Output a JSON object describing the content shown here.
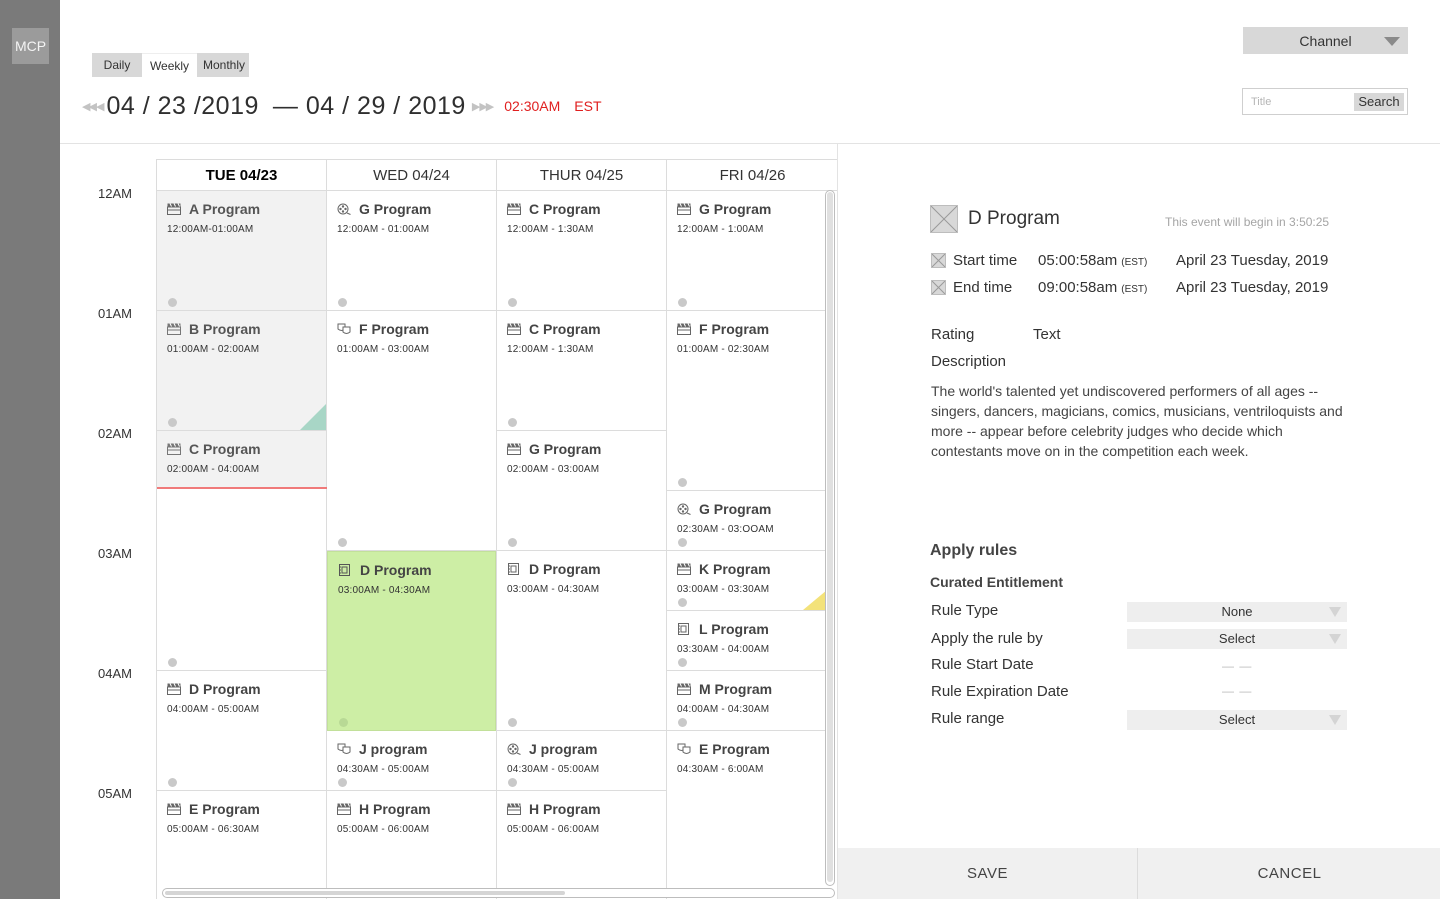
{
  "app": {
    "logo": "MCP"
  },
  "header": {
    "view_tabs": [
      "Daily",
      "Weekly",
      "Monthly"
    ],
    "active_tab": "Weekly",
    "date_start": "04 / 23 /2019",
    "date_separator": "—",
    "date_end": "04 / 29 / 2019",
    "current_time": "02:30AM",
    "timezone": "EST",
    "channel_label": "Channel",
    "search_placeholder": "Title",
    "search_button": "Search"
  },
  "calendar": {
    "time_labels": [
      "12AM",
      "01AM",
      "02AM",
      "03AM",
      "04AM",
      "05AM"
    ],
    "days": [
      "TUE 04/23",
      "WED 04/24",
      "THUR 04/25",
      "FRI 04/26"
    ],
    "active_day": "TUE 04/23",
    "events": {
      "tue": [
        {
          "title": "A Program",
          "time": "12:00AM-01:00AM",
          "icon": "clapperboard-icon"
        },
        {
          "title": "B  Program",
          "time": "01:00AM - 02:00AM",
          "icon": "clapperboard-icon"
        },
        {
          "title": "C Program",
          "time": "02:00AM - 04:00AM",
          "icon": "clapperboard-icon"
        },
        {
          "title": "D Program",
          "time": "04:00AM - 05:00AM",
          "icon": "clapperboard-icon"
        },
        {
          "title": "E Program",
          "time": "05:00AM - 06:30AM",
          "icon": "clapperboard-icon"
        }
      ],
      "wed": [
        {
          "title": "G Program",
          "time": "12:00AM - 01:00AM",
          "icon": "film-reel-icon"
        },
        {
          "title": "F Program",
          "time": "01:00AM - 03:00AM",
          "icon": "theater-masks-icon"
        },
        {
          "title": "D Program",
          "time": "03:00AM - 04:30AM",
          "icon": "film-strip-icon"
        },
        {
          "title": "J program",
          "time": "04:30AM - 05:00AM",
          "icon": "theater-masks-icon"
        },
        {
          "title": "H Program",
          "time": "05:00AM - 06:00AM",
          "icon": "clapperboard-icon"
        }
      ],
      "thu": [
        {
          "title": "C Program",
          "time": "12:00AM - 1:30AM",
          "icon": "clapperboard-icon"
        },
        {
          "title": "C Program",
          "time": "12:00AM - 1:30AM",
          "icon": "clapperboard-icon"
        },
        {
          "title": "G Program",
          "time": "02:00AM - 03:00AM",
          "icon": "clapperboard-icon"
        },
        {
          "title": "D Program",
          "time": "03:00AM - 04:30AM",
          "icon": "film-strip-icon"
        },
        {
          "title": "J program",
          "time": "04:30AM - 05:00AM",
          "icon": "film-reel-icon"
        },
        {
          "title": "H Program",
          "time": "05:00AM - 06:00AM",
          "icon": "clapperboard-icon"
        }
      ],
      "fri": [
        {
          "title": "G Program",
          "time": "12:00AM - 1:00AM",
          "icon": "clapperboard-icon"
        },
        {
          "title": "F Program",
          "time": "01:00AM - 02:30AM",
          "icon": "clapperboard-icon"
        },
        {
          "title": "G Program",
          "time": "02:30AM - 03:OOAM",
          "icon": "film-reel-icon"
        },
        {
          "title": "K Program",
          "time": "03:00AM - 03:30AM",
          "icon": "clapperboard-icon"
        },
        {
          "title": "L Program",
          "time": "03:30AM - 04:00AM",
          "icon": "film-strip-icon"
        },
        {
          "title": "M Program",
          "time": "04:00AM - 04:30AM",
          "icon": "clapperboard-icon"
        },
        {
          "title": "E Program",
          "time": "04:30AM - 6:00AM",
          "icon": "theater-masks-icon"
        }
      ]
    }
  },
  "detail": {
    "title": "D Program",
    "note": "This event will begin in 3:50:25",
    "start_label": "Start time",
    "start_time": "05:00:58am",
    "start_tz": "(EST)",
    "start_date": "April 23 Tuesday, 2019",
    "end_label": "End time",
    "end_time": "09:00:58am",
    "end_tz": "(EST)",
    "end_date": "April 23 Tuesday, 2019",
    "rating_label": "Rating",
    "rating_value": "Text",
    "description_label": "Description",
    "description": "The world's talented yet undiscovered performers of all ages -- singers, dancers, magicians, comics, musicians, ventriloquists and more -- appear before celebrity judges who decide which contestants move on in the competition each week.",
    "rules_title": "Apply rules",
    "rules_subtitle": "Curated Entitlement",
    "rules": {
      "rule_type_label": "Rule Type",
      "rule_type_value": "None",
      "apply_by_label": "Apply the rule by",
      "apply_by_value": "Select",
      "start_date_label": "Rule Start Date",
      "start_date_value": "— —",
      "expiration_label": "Rule Expiration Date",
      "expiration_value": "— —",
      "range_label": "Rule range",
      "range_value": "Select"
    },
    "save_label": "SAVE",
    "cancel_label": "CANCEL"
  }
}
